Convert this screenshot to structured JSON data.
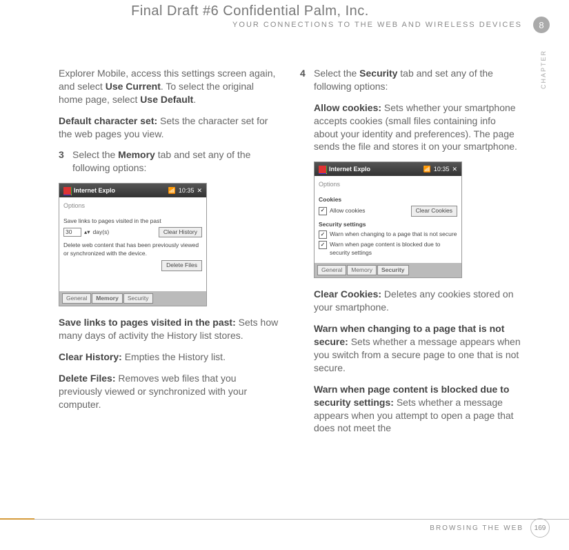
{
  "header": {
    "main": "Final Draft #6     Confidential     Palm, Inc.",
    "sub": "YOUR CONNECTIONS TO THE WEB AND WIRELESS DEVICES"
  },
  "chapter_num": "8",
  "chapter_label": "CHAPTER",
  "left": {
    "p1_a": "Explorer Mobile, access this settings screen again, and select ",
    "p1_b": "Use Current",
    "p1_c": ". To select the original home page, select ",
    "p1_d": "Use Default",
    "p1_e": ".",
    "p2_a": "Default character set:",
    "p2_b": " Sets the character set for the web pages you view.",
    "step3_num": "3",
    "step3_a": "Select the ",
    "step3_b": "Memory",
    "step3_c": " tab and set any of the following options:",
    "mock": {
      "title": "Internet Explo",
      "time": "10:35",
      "options_label": "Options",
      "save_text": "Save links to pages visited in the past",
      "days_value": "30",
      "days_label": "day(s)",
      "clear_history_btn": "Clear History",
      "delete_text": "Delete web content that has been previously viewed or synchronized with the device.",
      "delete_files_btn": "Delete Files",
      "tabs": [
        "General",
        "Memory",
        "Security"
      ]
    },
    "p3_a": "Save links to pages visited in the past:",
    "p3_b": " Sets how many days of activity the History list stores.",
    "p4_a": "Clear History:",
    "p4_b": " Empties the History list.",
    "p5_a": "Delete Files:",
    "p5_b": " Removes web files that you previously viewed or synchronized with your computer."
  },
  "right": {
    "step4_num": "4",
    "step4_a": "Select the ",
    "step4_b": "Security",
    "step4_c": " tab and set any of the following options:",
    "p1_a": "Allow cookies:",
    "p1_b": " Sets whether your smartphone accepts cookies (small files containing info about your identity and preferences). The page sends the file and stores it on your smartphone.",
    "mock": {
      "title": "Internet Explo",
      "time": "10:35",
      "options_label": "Options",
      "cookies_label": "Cookies",
      "allow_cookies": "Allow cookies",
      "clear_cookies_btn": "Clear Cookies",
      "sec_settings_label": "Security settings",
      "warn1": "Warn when changing to a page that is not secure",
      "warn2": "Warn when page content is blocked due to security settings",
      "tabs": [
        "General",
        "Memory",
        "Security"
      ]
    },
    "p2_a": "Clear Cookies:",
    "p2_b": " Deletes any cookies stored on your smartphone.",
    "p3_a": "Warn when changing to a page that is not secure:",
    "p3_b": " Sets whether a message appears when you switch from a secure page to one that is not secure.",
    "p4_a": "Warn when page content is blocked due to security settings:",
    "p4_b": " Sets whether a message appears when you attempt to open a page that does not meet the"
  },
  "footer": {
    "section": "BROWSING THE WEB",
    "page": "169"
  }
}
